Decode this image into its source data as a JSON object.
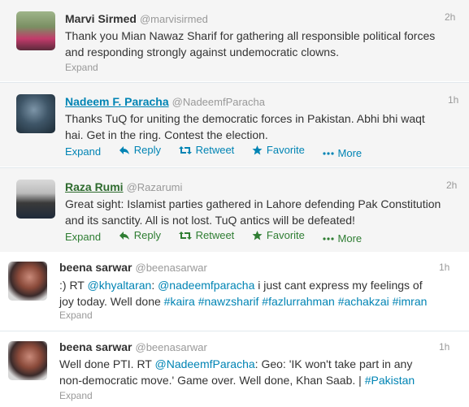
{
  "tweets": [
    {
      "name": "Marvi Sirmed",
      "handle": "@marvisirmed",
      "time": "2h",
      "lines": [
        "Thank you Mian Nawaz Sharif for gathering all responsible political forces",
        "and responding strongly against undemocratic clowns."
      ],
      "expand": "Expand"
    },
    {
      "name": "Nadeem F. Paracha",
      "handle": "@NadeemfParacha",
      "time": "1h",
      "lines": [
        "Thanks TuQ for uniting the democratic forces in Pakistan. Abhi bhi waqt",
        "hai. Get in the ring. Contest the election."
      ],
      "actions": {
        "expand": "Expand",
        "reply": "Reply",
        "retweet": "Retweet",
        "favorite": "Favorite",
        "more": "More"
      }
    },
    {
      "name": "Raza Rumi",
      "handle": "@Razarumi",
      "time": "2h",
      "lines": [
        "Great sight: Islamist parties gathered in Lahore defending Pak Constitution",
        "and its sanctity. All is not lost. TuQ antics will be defeated!"
      ],
      "actions": {
        "expand": "Expand",
        "reply": "Reply",
        "retweet": "Retweet",
        "favorite": "Favorite",
        "more": "More"
      }
    },
    {
      "name": "beena sarwar",
      "handle": "@beenasarwar",
      "time": "1h",
      "line1": {
        "prefix": ":) RT ",
        "m1": "@khyaltaran",
        "mid": ": ",
        "m2": "@nadeemfparacha",
        "rest": " i just cant express my feelings of"
      },
      "line2": {
        "prefix": "joy today. Well done ",
        "t1": "#kaira",
        "t2": "#nawzsharif",
        "t3": "#fazlurrahman",
        "t4": "#achakzai",
        "t5": "#imran"
      },
      "expand": "Expand"
    },
    {
      "name": "beena sarwar",
      "handle": "@beenasarwar",
      "time": "1h",
      "line1": {
        "prefix": "Well done PTI. RT ",
        "m1": "@NadeemfParacha",
        "rest": ": Geo: 'IK won't take part in any"
      },
      "line2": {
        "prefix": "non-democratic move.' Game over. Well done, Khan Saab. | ",
        "t1": "#Pakistan"
      },
      "expand": "Expand"
    }
  ]
}
